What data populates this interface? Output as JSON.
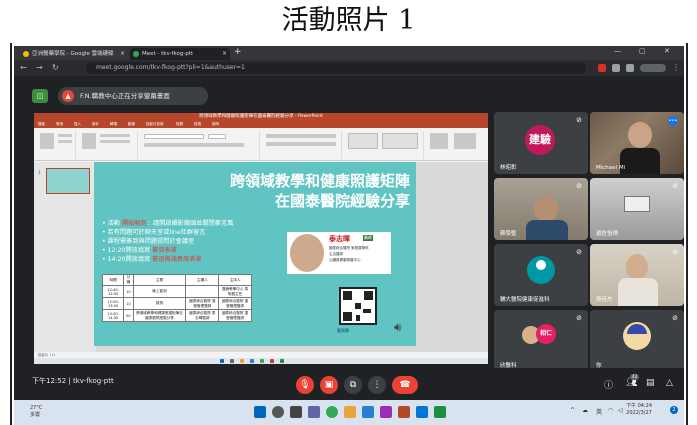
{
  "caption": "活動照片 1",
  "browser": {
    "tabs": [
      {
        "label": "亞洲醫藥學院 - Google 雲端硬碟",
        "active": false
      },
      {
        "label": "Meet - tkv-fkog-ptt",
        "active": true
      }
    ],
    "url": "meet.google.com/tkv-fkog-ptt?pli=1&authuser=1"
  },
  "presenting": {
    "banner": "F.N.職教中心正在分享螢幕畫面"
  },
  "powerpoint": {
    "title_bar": "跨領域教學和健康照護矩陣在國泰醫院經驗分享 - PowerPoint",
    "ribbon_tabs": [
      "檔案",
      "常用",
      "插入",
      "設計",
      "轉場",
      "動畫",
      "投影片放映",
      "校閱",
      "檢視",
      "說明"
    ],
    "status": "投影片 1/1",
    "slide": {
      "title_line1": "跨領域教學和健康照護矩陣",
      "title_line2": "在國泰醫院經驗分享",
      "bullets": [
        {
          "text": "• 活動 開始報到：請開啟攝影鏡頭並關閉麥克風",
          "highlight": "開始報到"
        },
        {
          "text": "• 若有問題可於聊天室或line社群留言",
          "highlight": ""
        },
        {
          "text": "• 課程需簽到與問題提問於會議室",
          "highlight": ""
        },
        {
          "text": "• 12:20開放填寫 簽到表單",
          "highlight": "簽到表單"
        },
        {
          "text": "• 14:20開放填寫 簽退與滿意度表單",
          "highlight": "簽退與滿意度表單"
        }
      ],
      "schedule": {
        "headers": [
          "時間",
          "分鐘",
          "主題",
          "主講人",
          "主持人"
        ],
        "rows": [
          [
            "12:40-12:50",
            "10",
            "線上簽到",
            "",
            "醫療教學中心 馬明昌主任"
          ],
          [
            "12:50-13:00",
            "10",
            "致詞",
            "國泰綜合醫院 運營管理醫師",
            "國泰綜合醫院 運營管理醫師"
          ],
          [
            "13:00-14:30",
            "90",
            "跨領域教學和健康照護矩陣在國泰醫院經驗分享",
            "國泰綜合醫院 泰志暉醫師",
            "國泰綜合醫院 運營管理醫師"
          ]
        ]
      },
      "speaker": {
        "name": "泰志暉",
        "title": "醫師",
        "desc_lines": [
          "國泰綜合醫院 家庭醫學科",
          "主治醫師",
          "心臟與健康照護中心"
        ]
      },
      "qr_label": "簽到單"
    }
  },
  "participants": [
    {
      "name": "林昭彰",
      "avatar_text": "建驗",
      "avatar_color": "#c2185b",
      "type": "avatar"
    },
    {
      "name": "Michael Mi",
      "avatar_text": "",
      "avatar_color": "",
      "type": "video"
    },
    {
      "name": "蘇學聖",
      "avatar_text": "",
      "avatar_color": "",
      "type": "video"
    },
    {
      "name": "遊佐怡璋",
      "avatar_text": "",
      "avatar_color": "",
      "type": "video"
    },
    {
      "name": "輔大醫院健康促進科",
      "avatar_text": "",
      "avatar_color": "#0097a7",
      "type": "avatar"
    },
    {
      "name": "吳佳杰",
      "avatar_text": "",
      "avatar_color": "",
      "type": "video"
    },
    {
      "name": "欣醫科",
      "avatar_text": "相仁",
      "avatar_color": "#e91e63",
      "type": "avatar"
    },
    {
      "name": "你",
      "avatar_text": "",
      "avatar_color": "",
      "type": "avatar"
    }
  ],
  "meeting": {
    "time_code": "下午12:52 | tkv-fkog-ptt",
    "participant_count": "43"
  },
  "windows_taskbar": {
    "weather_temp": "27°C",
    "weather_desc": "多雲",
    "lang": "英",
    "time": "下午 04:24",
    "date": "2022/3/27"
  },
  "colors": {
    "meet_bg": "#202124",
    "tile_bg": "#3c4043",
    "end_call": "#ea4335",
    "slide_teal": "#5fc4c2",
    "ppt_red": "#b7472a"
  }
}
